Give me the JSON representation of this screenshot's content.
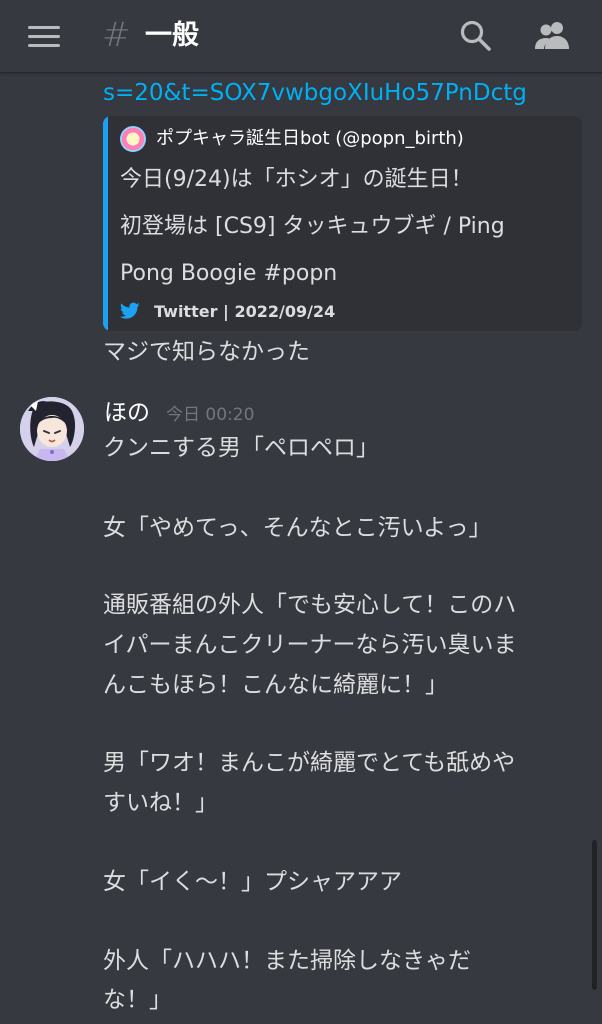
{
  "header": {
    "menu_icon": "hamburger-menu-icon",
    "hash_symbol": "#",
    "channel_name": "一般",
    "search_icon": "search-icon",
    "members_icon": "members-icon"
  },
  "previous_message": {
    "link_fragment": "s=20&t=SOX7vwbgoXIuHo57PnDctg",
    "embed": {
      "accent_color": "#1da1f2",
      "author": "ポプキャラ誕生日bot (@popn_birth)",
      "description_lines": [
        "今日(9/24)は「ホシオ」の誕生日！",
        "初登場は [CS9] タッキュウブギ / Ping",
        "Pong Boogie #popn"
      ],
      "footer_icon": "twitter-icon",
      "footer": "Twitter | 2022/09/24"
    },
    "text": "マジで知らなかった"
  },
  "message": {
    "username": "ほの",
    "timestamp": "今日 00:20",
    "lines": [
      "クンニする男「ペロペロ」",
      "女「やめてっ、そんなとこ汚いよっ」",
      "通販番組の外人「でも安心して！このハ",
      "イパーまんこクリーナーなら汚い臭いま",
      "んこもほら！こんなに綺麗に！」",
      "男「ワオ！まんこが綺麗でとても舐めや",
      "すいね！」",
      "女「イく〜！」プシャアアア",
      "外人「ハハハ！また掃除しなきゃだ",
      "な！」"
    ]
  },
  "colors": {
    "background": "#36393f",
    "embed_background": "#2f3136",
    "link": "#00b0f4",
    "text": "#dcddde",
    "muted": "#72767d"
  }
}
